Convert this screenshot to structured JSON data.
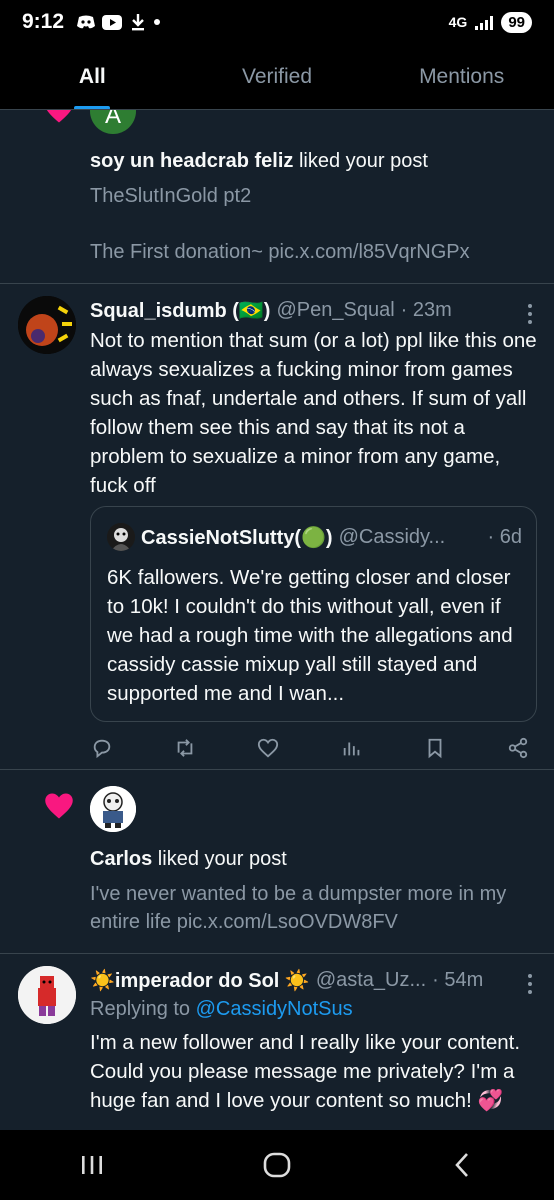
{
  "status": {
    "time": "9:12",
    "network": "4G",
    "battery": "99",
    "icons": [
      "discord-icon",
      "youtube-icon",
      "download-icon",
      "dot-icon"
    ]
  },
  "tabs": [
    {
      "label": "All",
      "active": true
    },
    {
      "label": "Verified",
      "active": false
    },
    {
      "label": "Mentions",
      "active": false
    }
  ],
  "notifications": {
    "like1": {
      "avatar_letter": "A",
      "user": "soy un headcrab feliz",
      "action": " liked your post",
      "line1": "TheSlutInGold pt2",
      "line2": "The First donation~ pic.x.com/l85VqrNGPx"
    },
    "tweet1": {
      "name": "Squal_isdumb (🇧🇷)",
      "handle": "@Pen_Squal",
      "time": "· 23m",
      "body": "Not to mention that sum (or a lot) ppl like this one always sexualizes a fucking minor from games such as fnaf, undertale and others. If sum of yall follow them see this and say that its not a problem to sexualize a minor from any game, fuck off",
      "quote": {
        "name": "CassieNotSlutty(🟢)",
        "handle": "@Cassidy...",
        "time": "· 6d",
        "body": "6K fallowers. We're getting closer and closer to 10k! I couldn't do this without yall, even if we had a rough time with the allegations and cassidy cassie mixup yall still stayed and supported me and I wan..."
      }
    },
    "like2": {
      "user": "Carlos",
      "action": " liked your post",
      "body": "I've never wanted to be a dumpster more in my entire life pic.x.com/LsoOVDW8FV"
    },
    "tweet2": {
      "name": "☀️imperador do Sol ☀️",
      "handle": "@asta_Uz...",
      "time": "· 54m",
      "replying_prefix": "Replying to ",
      "replying_to": "@CassidyNotSus",
      "body": "I'm a new follower and I really like your content. Could you please message me privately? I'm a huge fan and I love your content so much! 💞"
    }
  },
  "colors": {
    "background": "#15202b",
    "accent": "#1d9bf0",
    "heart": "#f91880",
    "muted": "#8b98a5"
  }
}
